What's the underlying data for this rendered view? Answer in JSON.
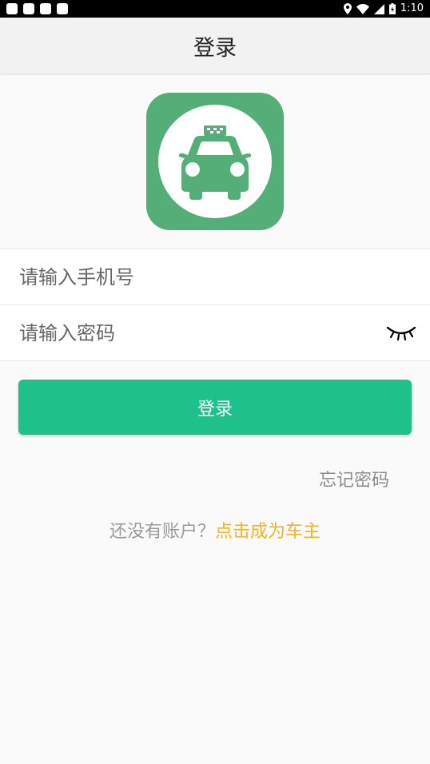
{
  "status_bar": {
    "time": "1:10"
  },
  "header": {
    "title": "登录"
  },
  "logo": {
    "background_color": "#54ae77",
    "icon": "taxi-icon"
  },
  "form": {
    "phone_placeholder": "请输入手机号",
    "password_placeholder": "请输入密码",
    "password_toggle_icon": "eye-closed-icon"
  },
  "login_button": {
    "label": "登录",
    "color": "#1fc18b"
  },
  "forgot_password": {
    "label": "忘记密码"
  },
  "register": {
    "prompt": "还没有账户？",
    "link_label": "点击成为车主",
    "link_color": "#f0b429"
  }
}
